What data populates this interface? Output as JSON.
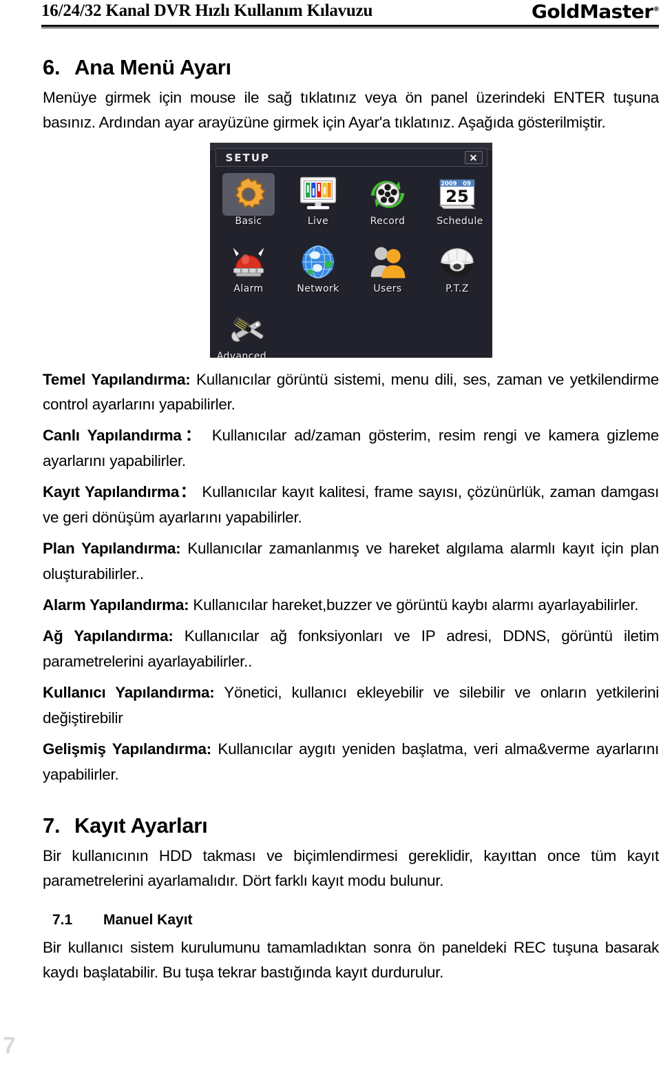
{
  "header": {
    "title": "16/24/32 Kanal DVR Hızlı Kullanım Kılavuzu",
    "brand": "GoldMaster",
    "brand_mark": "®"
  },
  "section6": {
    "number": "6.",
    "title": "Ana Menü Ayarı",
    "intro": "Menüye girmek için mouse ile sağ tıklatınız veya ön panel üzerindeki ENTER tuşuna basınız. Ardından ayar arayüzüne girmek için Ayar'a tıklatınız. Aşağıda gösterilmiştir.",
    "paragraphs": [
      {
        "label": "Temel Yapılandırma:",
        "text": " Kullanıcılar görüntü sistemi, menu dili, ses, zaman ve yetkilendirme control ayarlarını yapabilirler."
      },
      {
        "label": "Canlı Yapılandırma：",
        "text": " Kullanıcılar ad/zaman gösterim, resim rengi ve kamera gizleme ayarlarını yapabilirler."
      },
      {
        "label": "Kayıt Yapılandırma：",
        "text": " Kullanıcılar kayıt kalitesi, frame sayısı, çözünürlük, zaman damgası ve geri dönüşüm ayarlarını yapabilirler."
      },
      {
        "label": "Plan Yapılandırma:",
        "text": " Kullanıcılar zamanlanmış ve hareket algılama alarmlı kayıt için plan oluşturabilirler.."
      },
      {
        "label": "Alarm Yapılandırma:",
        "text": " Kullanıcılar hareket,buzzer ve görüntü kaybı alarmı ayarlayabilirler."
      },
      {
        "label": "Ağ Yapılandırma:",
        "text": " Kullanıcılar ağ fonksiyonları ve IP adresi, DDNS, görüntü iletim parametrelerini ayarlayabilirler.."
      },
      {
        "label": "Kullanıcı Yapılandırma:",
        "text": " Yönetici, kullanıcı ekleyebilir ve silebilir ve onların yetkilerini değiştirebilir"
      },
      {
        "label": "Gelişmiş Yapılandırma:",
        "text": " Kullanıcılar aygıtı yeniden başlatma, veri alma&verme ayarlarını yapabilirler."
      }
    ]
  },
  "setup_dialog": {
    "title": "SETUP",
    "close_label": "✕",
    "calendar": {
      "year": "2009",
      "month": "09",
      "day": "25"
    },
    "items": [
      {
        "label": "Basic",
        "icon": "gear-icon",
        "selected": true
      },
      {
        "label": "Live",
        "icon": "monitor-icon",
        "selected": false
      },
      {
        "label": "Record",
        "icon": "film-reel-icon",
        "selected": false
      },
      {
        "label": "Schedule",
        "icon": "calendar-icon",
        "selected": false
      },
      {
        "label": "Alarm",
        "icon": "siren-icon",
        "selected": false
      },
      {
        "label": "Network",
        "icon": "globe-icon",
        "selected": false
      },
      {
        "label": "Users",
        "icon": "users-icon",
        "selected": false
      },
      {
        "label": "P.T.Z",
        "icon": "dome-camera-icon",
        "selected": false
      },
      {
        "label": "Advanced",
        "icon": "tools-icon",
        "selected": false
      }
    ]
  },
  "section7": {
    "number": "7.",
    "title": "Kayıt Ayarları",
    "intro": "Bir kullanıcının HDD takması ve biçimlendirmesi gereklidir, kayıttan once tüm kayıt parametrelerini ayarlamalıdır. Dört farklı kayıt modu bulunur.",
    "sub": {
      "number": "7.1",
      "title": "Manuel Kayıt",
      "text": "Bir kullanıcı sistem kurulumunu tamamladıktan sonra ön paneldeki REC tuşuna basarak kaydı başlatabilir. Bu tuşa tekrar bastığında kayıt durdurulur."
    }
  },
  "footer": {
    "page_number": "7"
  }
}
